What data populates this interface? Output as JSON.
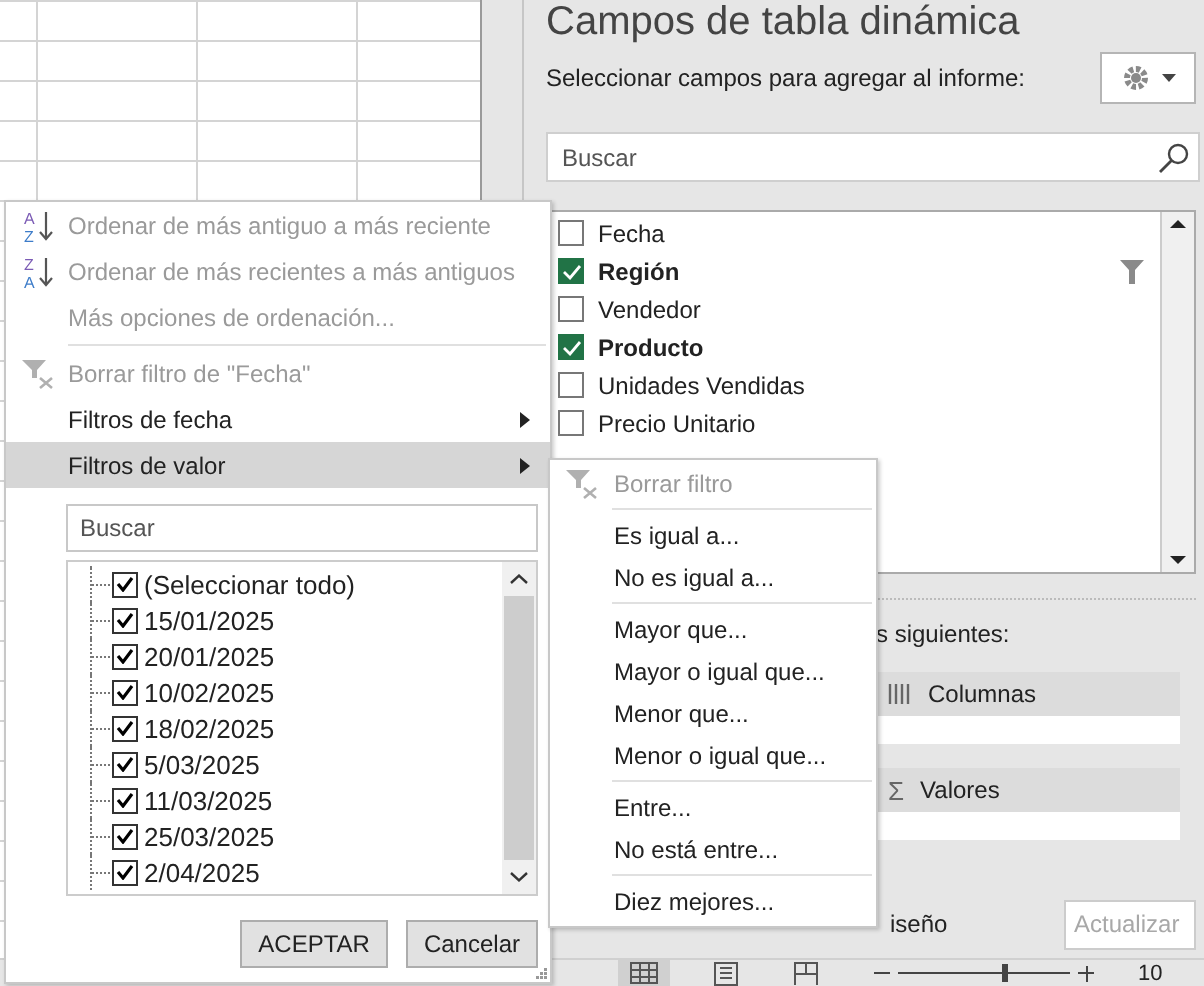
{
  "pane": {
    "title": "Campos de tabla dinámica",
    "prompt": "Seleccionar campos para agregar al informe:",
    "search": {
      "placeholder": "Buscar"
    },
    "fields": [
      {
        "label": "Fecha",
        "checked": false,
        "filtered": false
      },
      {
        "label": "Región",
        "checked": true,
        "filtered": true
      },
      {
        "label": "Vendedor",
        "checked": false,
        "filtered": false
      },
      {
        "label": "Producto",
        "checked": true,
        "filtered": false
      },
      {
        "label": "Unidades Vendidas",
        "checked": false,
        "filtered": false
      },
      {
        "label": "Precio Unitario",
        "checked": false,
        "filtered": false
      }
    ],
    "areas_hint": "s siguientes:",
    "areas": [
      {
        "kind": "columns",
        "label": "Columnas"
      },
      {
        "kind": "values",
        "label": "Valores",
        "icon_text": "Σ"
      }
    ],
    "defer_label": "iseño",
    "update_button": {
      "label": "Actualizar",
      "disabled": true
    }
  },
  "filter_menu": {
    "items": [
      {
        "kind": "sort",
        "label": "Ordenar de más antiguo a más reciente",
        "icon_letters": [
          "A",
          "Z"
        ],
        "disabled": true,
        "submenu": false,
        "selected": false
      },
      {
        "kind": "sort",
        "label": "Ordenar de más recientes a más antiguos",
        "icon_letters": [
          "Z",
          "A"
        ],
        "disabled": true,
        "submenu": false,
        "selected": false
      },
      {
        "kind": "item",
        "label": "Más opciones de ordenación...",
        "disabled": true,
        "submenu": false,
        "selected": false
      },
      {
        "kind": "separator"
      },
      {
        "kind": "clear",
        "label": "Borrar filtro de \"Fecha\"",
        "disabled": true,
        "submenu": false,
        "selected": false
      },
      {
        "kind": "item",
        "label": "Filtros de fecha",
        "disabled": false,
        "submenu": true,
        "selected": false
      },
      {
        "kind": "item",
        "label": "Filtros de valor",
        "disabled": false,
        "submenu": true,
        "selected": true
      }
    ],
    "search": {
      "placeholder": "Buscar"
    },
    "values": [
      {
        "label": "(Seleccionar todo)",
        "checked": true
      },
      {
        "label": "15/01/2025",
        "checked": true
      },
      {
        "label": "20/01/2025",
        "checked": true
      },
      {
        "label": "10/02/2025",
        "checked": true
      },
      {
        "label": "18/02/2025",
        "checked": true
      },
      {
        "label": "5/03/2025",
        "checked": true
      },
      {
        "label": "11/03/2025",
        "checked": true
      },
      {
        "label": "25/03/2025",
        "checked": true
      },
      {
        "label": "2/04/2025",
        "checked": true
      }
    ],
    "buttons": [
      "ACEPTAR",
      "Cancelar"
    ]
  },
  "submenu": {
    "items": [
      {
        "kind": "clear",
        "label": "Borrar filtro",
        "disabled": true
      },
      {
        "kind": "separator"
      },
      {
        "kind": "item",
        "label": "Es igual a...",
        "disabled": false
      },
      {
        "kind": "item",
        "label": "No es igual a...",
        "disabled": false
      },
      {
        "kind": "separator"
      },
      {
        "kind": "item",
        "label": "Mayor que...",
        "disabled": false
      },
      {
        "kind": "item",
        "label": "Mayor o igual que...",
        "disabled": false
      },
      {
        "kind": "item",
        "label": "Menor que...",
        "disabled": false
      },
      {
        "kind": "item",
        "label": "Menor o igual que...",
        "disabled": false
      },
      {
        "kind": "separator"
      },
      {
        "kind": "item",
        "label": "Entre...",
        "disabled": false
      },
      {
        "kind": "item",
        "label": "No está entre...",
        "disabled": false
      },
      {
        "kind": "separator"
      },
      {
        "kind": "item",
        "label": "Diez mejores...",
        "disabled": false
      }
    ]
  },
  "status_bar": {
    "zoom_slider": {
      "level": 0.6
    },
    "zoom": "10"
  }
}
